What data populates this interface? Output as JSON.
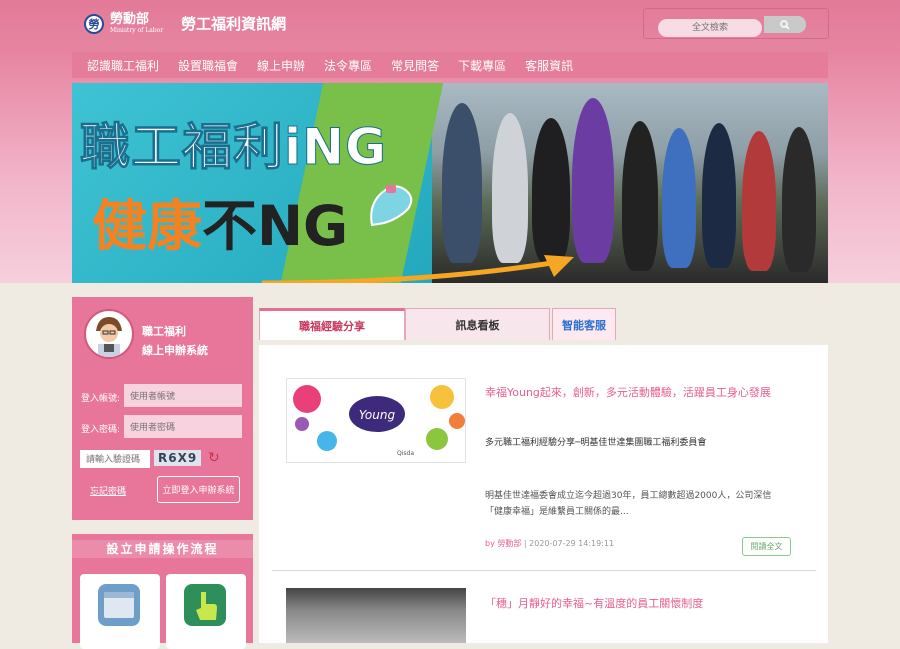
{
  "header": {
    "logo_main": "勞動部",
    "logo_sub": "Ministry of Labor",
    "site_title": "勞工福利資訊網",
    "search_placeholder": "全文檢索"
  },
  "nav": {
    "items": [
      "認識職工福利",
      "設置職福會",
      "線上申辦",
      "法令專區",
      "常見問答",
      "下載專區",
      "客服資訊"
    ]
  },
  "banner": {
    "line1": "職工福利iNG",
    "line2a": "健康",
    "line2b": "不NG"
  },
  "login": {
    "title_line1": "職工福利",
    "title_line2": "線上申辦系統",
    "account_label": "登入帳號:",
    "account_placeholder": "使用者帳號",
    "password_label": "登入密碼:",
    "password_placeholder": "使用者密碼",
    "captcha_placeholder": "請輸入驗證碼",
    "captcha_code": "R6X9",
    "forgot": "忘記密碼",
    "login_button": "立即登入申辦系統"
  },
  "flow": {
    "title": "設立申請操作流程"
  },
  "tabs": [
    "職福經驗分享",
    "訊息看板",
    "智能客服"
  ],
  "articles": [
    {
      "title": "幸福Young起來，創新，多元活動體驗，活躍員工身心發展",
      "subtitle": "多元職工福利經驗分享─明基佳世達集團職工福利委員會",
      "desc": "明基佳世達福委會成立迄今超過30年，員工總數超過2000人，公司深信「健康幸福」是維繫員工關係的最...",
      "author": "by 勞動部",
      "date": "| 2020-07-29 14:19:11",
      "read_more": "閱讀全文"
    },
    {
      "title": "「穗」月靜好的幸福~有溫度的員工關懷制度"
    }
  ],
  "colors": {
    "brand_pink": "#e47c9a",
    "accent": "#e85f8d"
  }
}
